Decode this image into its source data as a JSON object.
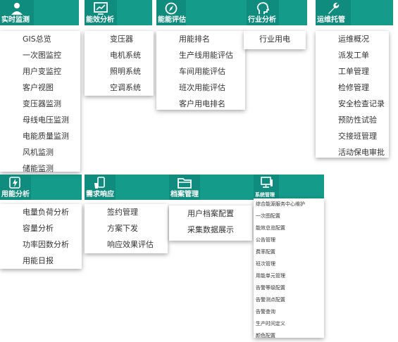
{
  "menus": [
    {
      "title": "实时监测",
      "icon": "user-monitor-icon",
      "items": [
        "GIS总览",
        "一次图监控",
        "用户变监控",
        "客户视图",
        "变压器监测",
        "母线电压监测",
        "电能质量监测",
        "风机监测",
        "储能监测"
      ]
    },
    {
      "title": "能效分析",
      "icon": "chart-screen-icon",
      "items": [
        "变压器",
        "电机系统",
        "照明系统",
        "空调系统"
      ]
    },
    {
      "title": "能能评估",
      "icon": "compass-icon",
      "items": [
        "用能排名",
        "生产线用能评估",
        "车间用能评估",
        "班次用能评估",
        "客户用电排名"
      ]
    },
    {
      "title": "行业分析",
      "icon": "head-profile-icon",
      "items": [
        "行业用电"
      ]
    },
    {
      "title": "运维托管",
      "icon": "wrench-icon",
      "items": [
        "运维概况",
        "派发工单",
        "工单管理",
        "检修管理",
        "安全检查记录",
        "预防性试验",
        "交接班管理",
        "活动保电审批"
      ]
    },
    {
      "title": "用能分析",
      "icon": "lightning-doc-icon",
      "items": [
        "电量负荷分析",
        "容量分析",
        "功率因数分析",
        "用能日报"
      ]
    },
    {
      "title": "需求响应",
      "icon": "phone-hand-icon",
      "items": [
        "签约管理",
        "方案下发",
        "响应效果评估"
      ]
    },
    {
      "title": "档案管理",
      "icon": "folder-icon",
      "items": [
        "用户档案配置",
        "采集数据展示"
      ]
    },
    {
      "title": "系统管理",
      "icon": "monitor-icon",
      "items": [
        "综合能源服务中心维护",
        "一次图配置",
        "能效总览配置",
        "公告管理",
        "费率配置",
        "班次管理",
        "用能单元管理",
        "告警等级配置",
        "告警测点配置",
        "告警查询",
        "生产时间定义",
        "颜色配置"
      ]
    }
  ],
  "colors": {
    "header": "#159b8a",
    "tab": "#0f8c7d"
  }
}
